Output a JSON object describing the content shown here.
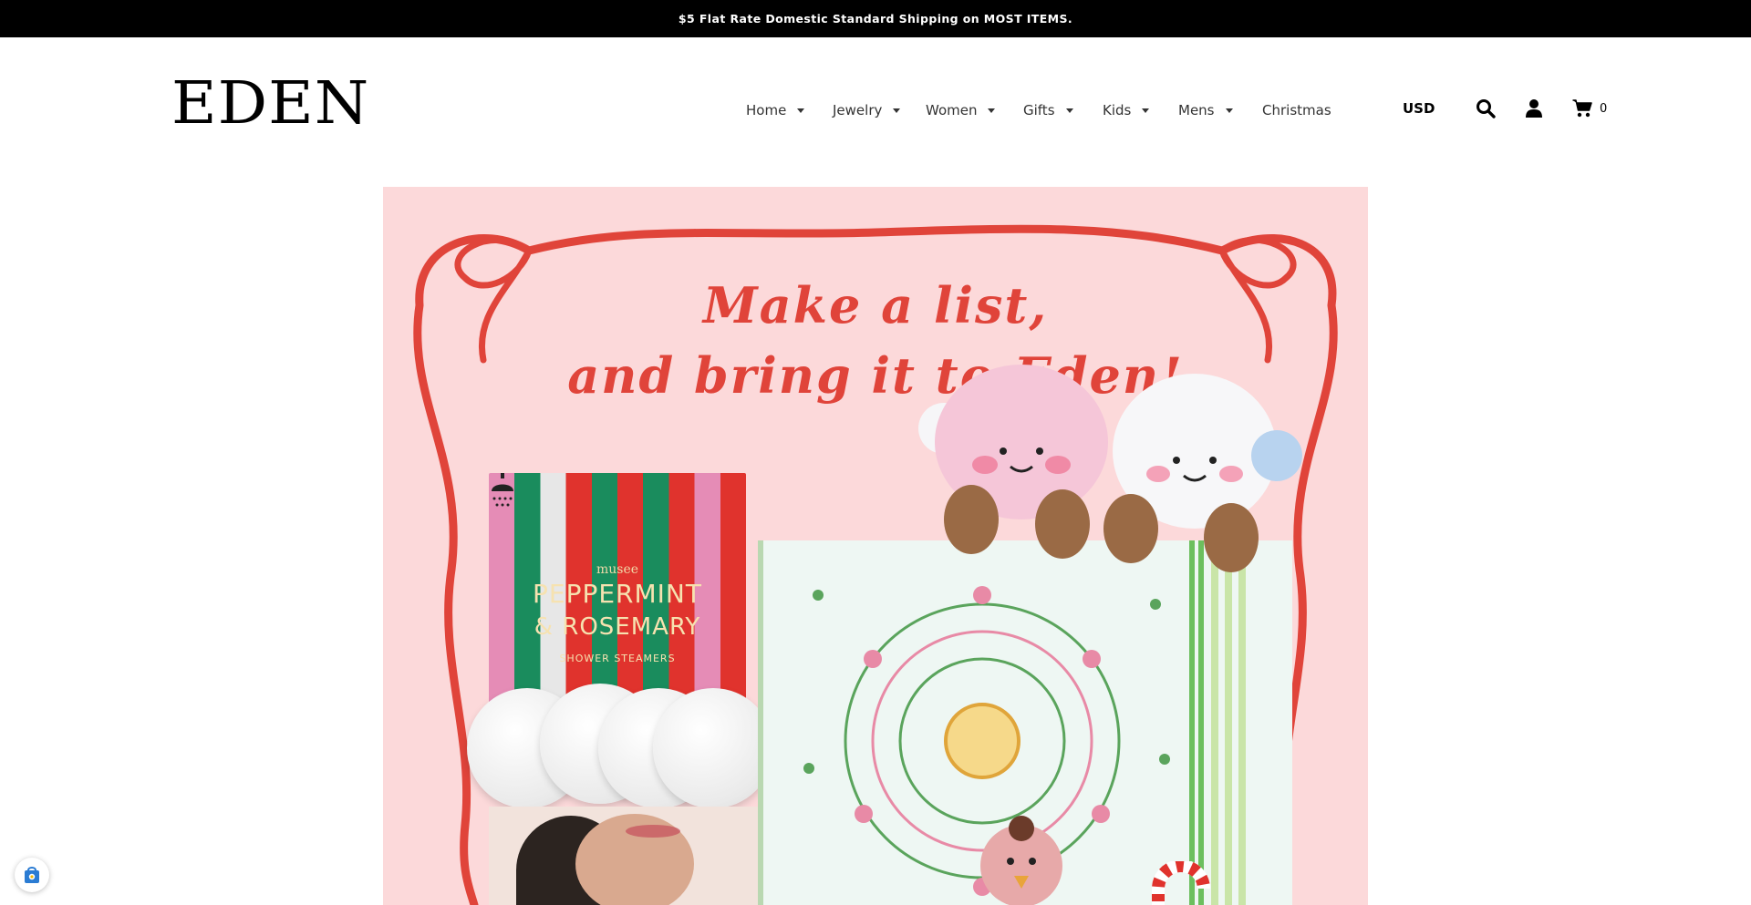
{
  "announcement": {
    "text": "$5 Flat Rate Domestic Standard Shipping on MOST ITEMS."
  },
  "brand": {
    "logo_text": "EDEN"
  },
  "nav": {
    "items": [
      {
        "label": "Home",
        "has_dropdown": true
      },
      {
        "label": "Jewelry",
        "has_dropdown": true
      },
      {
        "label": "Women",
        "has_dropdown": true
      },
      {
        "label": "Gifts",
        "has_dropdown": true
      },
      {
        "label": "Kids",
        "has_dropdown": true
      },
      {
        "label": "Mens",
        "has_dropdown": true
      },
      {
        "label": "Christmas",
        "has_dropdown": false
      }
    ]
  },
  "header_tools": {
    "currency": "USD",
    "search_icon": "search-icon",
    "account_icon": "user-icon",
    "cart_icon": "cart-icon",
    "cart_count": "0"
  },
  "hero": {
    "title_line1": "Make a list,",
    "title_line2": "and bring it to Eden!",
    "product_box": {
      "brand": "musee",
      "line1": "PEPPERMINT",
      "line2": "& ROSEMARY",
      "line3": "SHOWER STEAMERS"
    }
  },
  "floating_badge": {
    "icon": "shopping-bag-icon"
  },
  "colors": {
    "announcement_bg": "#000000",
    "hero_bg": "#fcd9da",
    "ribbon": "#e0443a"
  }
}
